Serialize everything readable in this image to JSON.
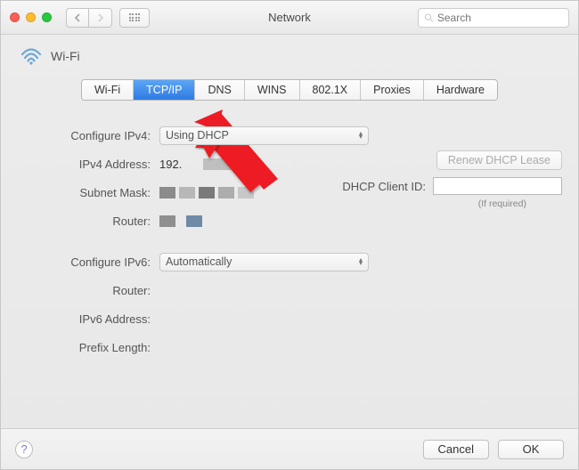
{
  "window": {
    "title": "Network"
  },
  "search": {
    "placeholder": "Search"
  },
  "header": {
    "connection_name": "Wi-Fi"
  },
  "tabs": [
    {
      "label": "Wi-Fi",
      "active": false
    },
    {
      "label": "TCP/IP",
      "active": true
    },
    {
      "label": "DNS",
      "active": false
    },
    {
      "label": "WINS",
      "active": false
    },
    {
      "label": "802.1X",
      "active": false
    },
    {
      "label": "Proxies",
      "active": false
    },
    {
      "label": "Hardware",
      "active": false
    }
  ],
  "form": {
    "configure_ipv4": {
      "label": "Configure IPv4:",
      "value": "Using DHCP"
    },
    "ipv4_address": {
      "label": "IPv4 Address:",
      "value_visible_prefix": "192."
    },
    "subnet_mask": {
      "label": "Subnet Mask:"
    },
    "router_v4": {
      "label": "Router:"
    },
    "configure_ipv6": {
      "label": "Configure IPv6:",
      "value": "Automatically"
    },
    "router_v6": {
      "label": "Router:"
    },
    "ipv6_address": {
      "label": "IPv6 Address:"
    },
    "prefix_length": {
      "label": "Prefix Length:"
    },
    "renew_button": "Renew DHCP Lease",
    "dhcp_client_id": {
      "label": "DHCP Client ID:",
      "hint": "(If required)"
    }
  },
  "footer": {
    "cancel": "Cancel",
    "ok": "OK"
  }
}
